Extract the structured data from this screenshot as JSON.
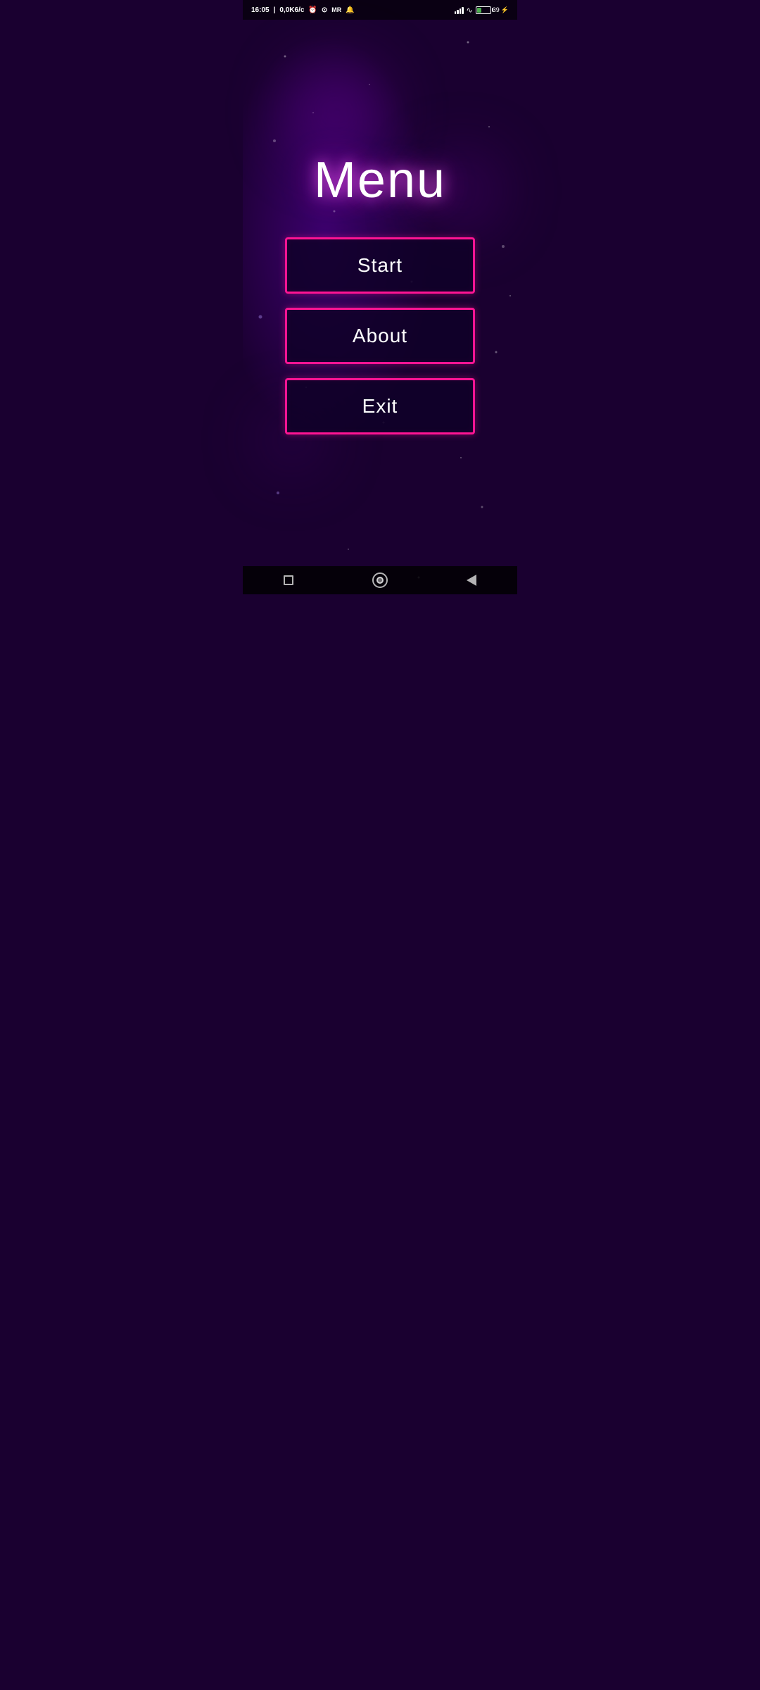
{
  "statusBar": {
    "time": "16:05",
    "dataSpeed": "0,0K6/c",
    "battery": "39",
    "icons": [
      "alarm-icon",
      "vpn-icon",
      "mr-icon",
      "notification-icon"
    ]
  },
  "page": {
    "title": "Menu"
  },
  "buttons": [
    {
      "id": "start",
      "label": "Start"
    },
    {
      "id": "about",
      "label": "About"
    },
    {
      "id": "exit",
      "label": "Exit"
    }
  ],
  "colors": {
    "background": "#1a0030",
    "accent": "#ff1493",
    "buttonBg": "#0f0028",
    "text": "#ffffff"
  },
  "navbar": {
    "square_label": "□",
    "circle_label": "○",
    "back_label": "◁"
  }
}
